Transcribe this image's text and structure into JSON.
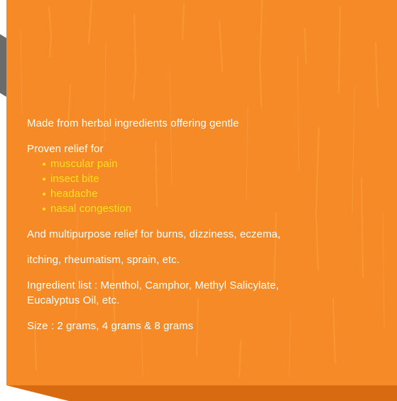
{
  "intro": "Made from herbal ingredients offering gentle",
  "relief_heading": "Proven relief for",
  "relief_items": [
    "muscular pain",
    "insect bite",
    "headache",
    "nasal congestion"
  ],
  "multipurpose_line1": "And multipurpose relief for burns, dizziness, eczema,",
  "multipurpose_line2": "itching, rheumatism, sprain, etc.",
  "ingredients_line1": "Ingredient list : Menthol, Camphor, Methyl Salicylate,",
  "ingredients_line2": "Eucalyptus Oil, etc.",
  "size": "Size : 2 grams, 4 grams & 8 grams",
  "colors": {
    "panel": "#f58a27",
    "band": "#d86a12",
    "highlight": "#ffe11a",
    "tab": "#6b6b6b"
  }
}
